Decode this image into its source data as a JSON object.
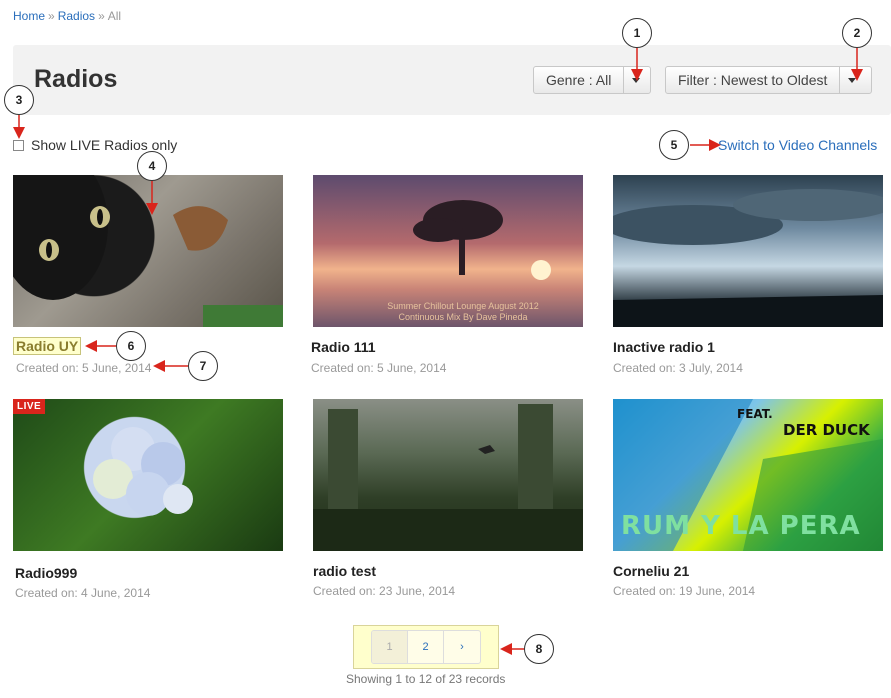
{
  "breadcrumb": {
    "home": "Home",
    "radios": "Radios",
    "current": "All",
    "sep": "»"
  },
  "header": {
    "title": "Radios",
    "genre_label": "Genre : All",
    "filter_label": "Filter : Newest to Oldest"
  },
  "live_toggle": {
    "label": "Show LIVE Radios only",
    "checked": false
  },
  "switch_link": "Switch to Video Channels",
  "cards": [
    {
      "title": "Radio UY",
      "date": "Created on: 5 June, 2014",
      "live": false,
      "image": "cat"
    },
    {
      "title": "Radio 111",
      "date": "Created on: 5 June, 2014",
      "live": false,
      "image": "sunset",
      "image_text": [
        "Summer Chillout Lounge August 2012",
        "Continuous Mix By Dave Pineda"
      ]
    },
    {
      "title": "Inactive radio 1",
      "date": "Created on: 3 July, 2014",
      "live": false,
      "image": "sky"
    },
    {
      "title": "Radio999",
      "date": "Created on: 4 June, 2014",
      "live": true,
      "live_label": "LIVE",
      "image": "flower"
    },
    {
      "title": "radio test",
      "date": "Created on: 23 June, 2014",
      "live": false,
      "image": "forest"
    },
    {
      "title": "Corneliu 21",
      "date": "Created on: 19 June, 2014",
      "live": false,
      "image": "pop",
      "image_text": [
        "FEAT.",
        "DER DUCK",
        "RUM Y LA PERA"
      ]
    }
  ],
  "pagination": {
    "pages": [
      "1",
      "2"
    ],
    "next": "›",
    "current": "1"
  },
  "records": "Showing 1 to 12 of 23 records",
  "callouts": [
    "1",
    "2",
    "3",
    "4",
    "5",
    "6",
    "7",
    "8"
  ],
  "colors": {
    "link": "#2a6ebb",
    "live_badge": "#d9251c",
    "highlight": "#ffffcc",
    "arrow": "#d9251c"
  }
}
